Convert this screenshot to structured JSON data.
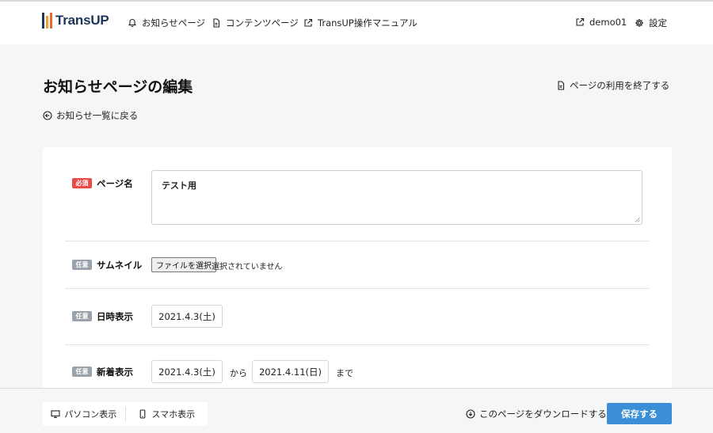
{
  "header": {
    "logo_text": "TransUP",
    "nav": {
      "notice_pages": "お知らせページ",
      "content_pages": "コンテンツページ",
      "manual": "TransUP操作マニュアル",
      "user": "demo01",
      "settings": "設定"
    }
  },
  "page": {
    "title": "お知らせページの編集",
    "end_usage": "ページの利用を終了する",
    "back_to_list": "お知らせ一覧に戻る"
  },
  "form": {
    "page_name": {
      "badge": "必須",
      "label": "ページ名",
      "value": "テスト用"
    },
    "thumbnail": {
      "badge": "任意",
      "label": "サムネイル",
      "button": "ファイルを選択",
      "status": "選択されていません"
    },
    "datetime_display": {
      "badge": "任意",
      "label": "日時表示",
      "value": "2021.4.3(土)"
    },
    "new_display": {
      "badge": "任意",
      "label": "新着表示",
      "from_value": "2021.4.3(土)",
      "from_text": "から",
      "to_value": "2021.4.11(日)",
      "to_text": "まで"
    }
  },
  "footer": {
    "pc_view": "パソコン表示",
    "sp_view": "スマホ表示",
    "download": "このページをダウンロードする",
    "save": "保存する"
  },
  "colors": {
    "primary": "#3a8fd6",
    "required_badge": "#e84a4a",
    "optional_badge": "#9aa3ab"
  }
}
